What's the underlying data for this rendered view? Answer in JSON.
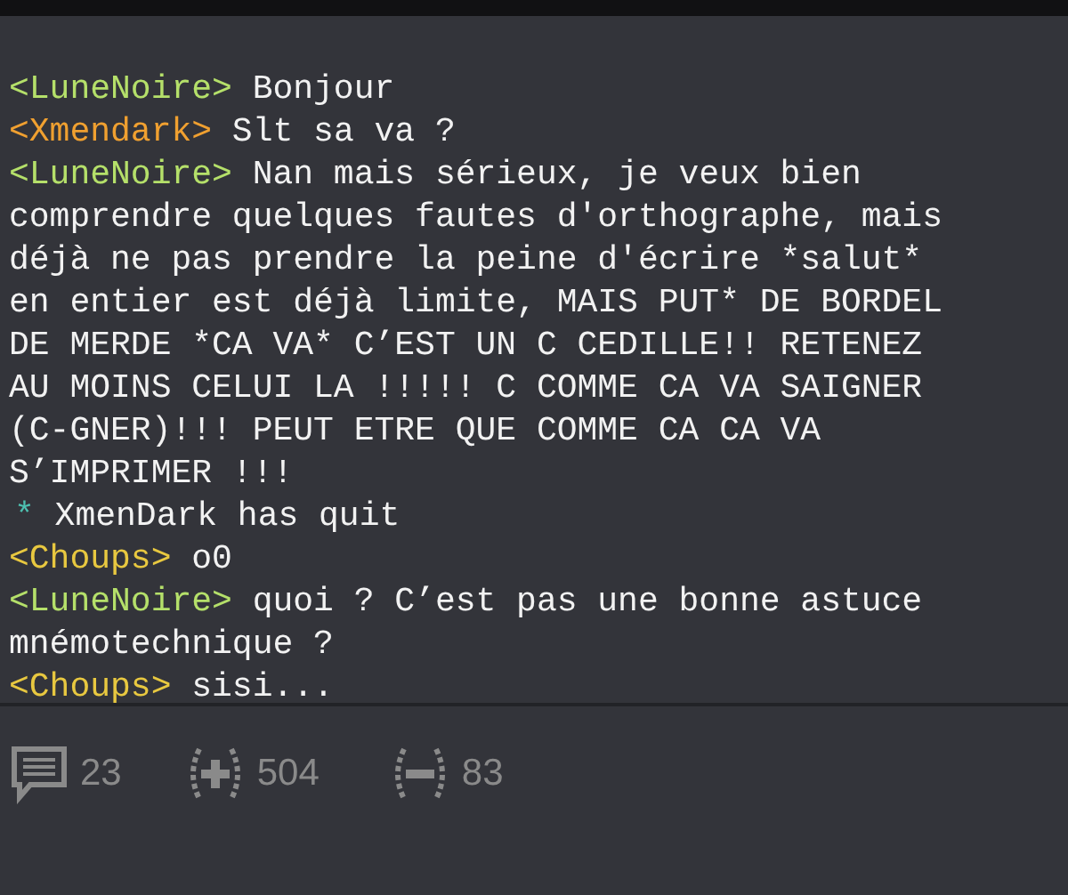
{
  "messages": [
    {
      "kind": "message",
      "nick": "<LuneNoire>",
      "color": "#b5e06a",
      "text": "Bonjour"
    },
    {
      "kind": "message",
      "nick": "<Xmendark>",
      "color": "#f0a030",
      "text": "Slt sa va ?"
    },
    {
      "kind": "message",
      "nick": "<LuneNoire>",
      "color": "#b5e06a",
      "text": "Nan mais sérieux, je veux bien comprendre quelques fautes d'orthographe, mais déjà ne pas prendre la peine d'écrire *salut* en entier est déjà limite, MAIS PUT* DE BORDEL DE MERDE *CA VA* C’EST UN C CEDILLE!! RETENEZ AU MOINS CELUI LA !!!!! C COMME CA VA SAIGNER (C-GNER)!!! PEUT ETRE QUE COMME CA CA VA S’IMPRIMER !!!"
    },
    {
      "kind": "event",
      "nick": "*",
      "color": "#4dc0b0",
      "text": "XmenDark has quit"
    },
    {
      "kind": "message",
      "nick": "<Choups>",
      "color": "#e8c840",
      "text": "o0"
    },
    {
      "kind": "message",
      "nick": "<LuneNoire>",
      "color": "#b5e06a",
      "text": "quoi ? C’est pas une bonne astuce mnémotechnique ?"
    },
    {
      "kind": "message",
      "nick": "<Choups>",
      "color": "#e8c840",
      "text": "sisi..."
    }
  ],
  "footer": {
    "comments": "23",
    "upvotes": "504",
    "downvotes": "83"
  }
}
